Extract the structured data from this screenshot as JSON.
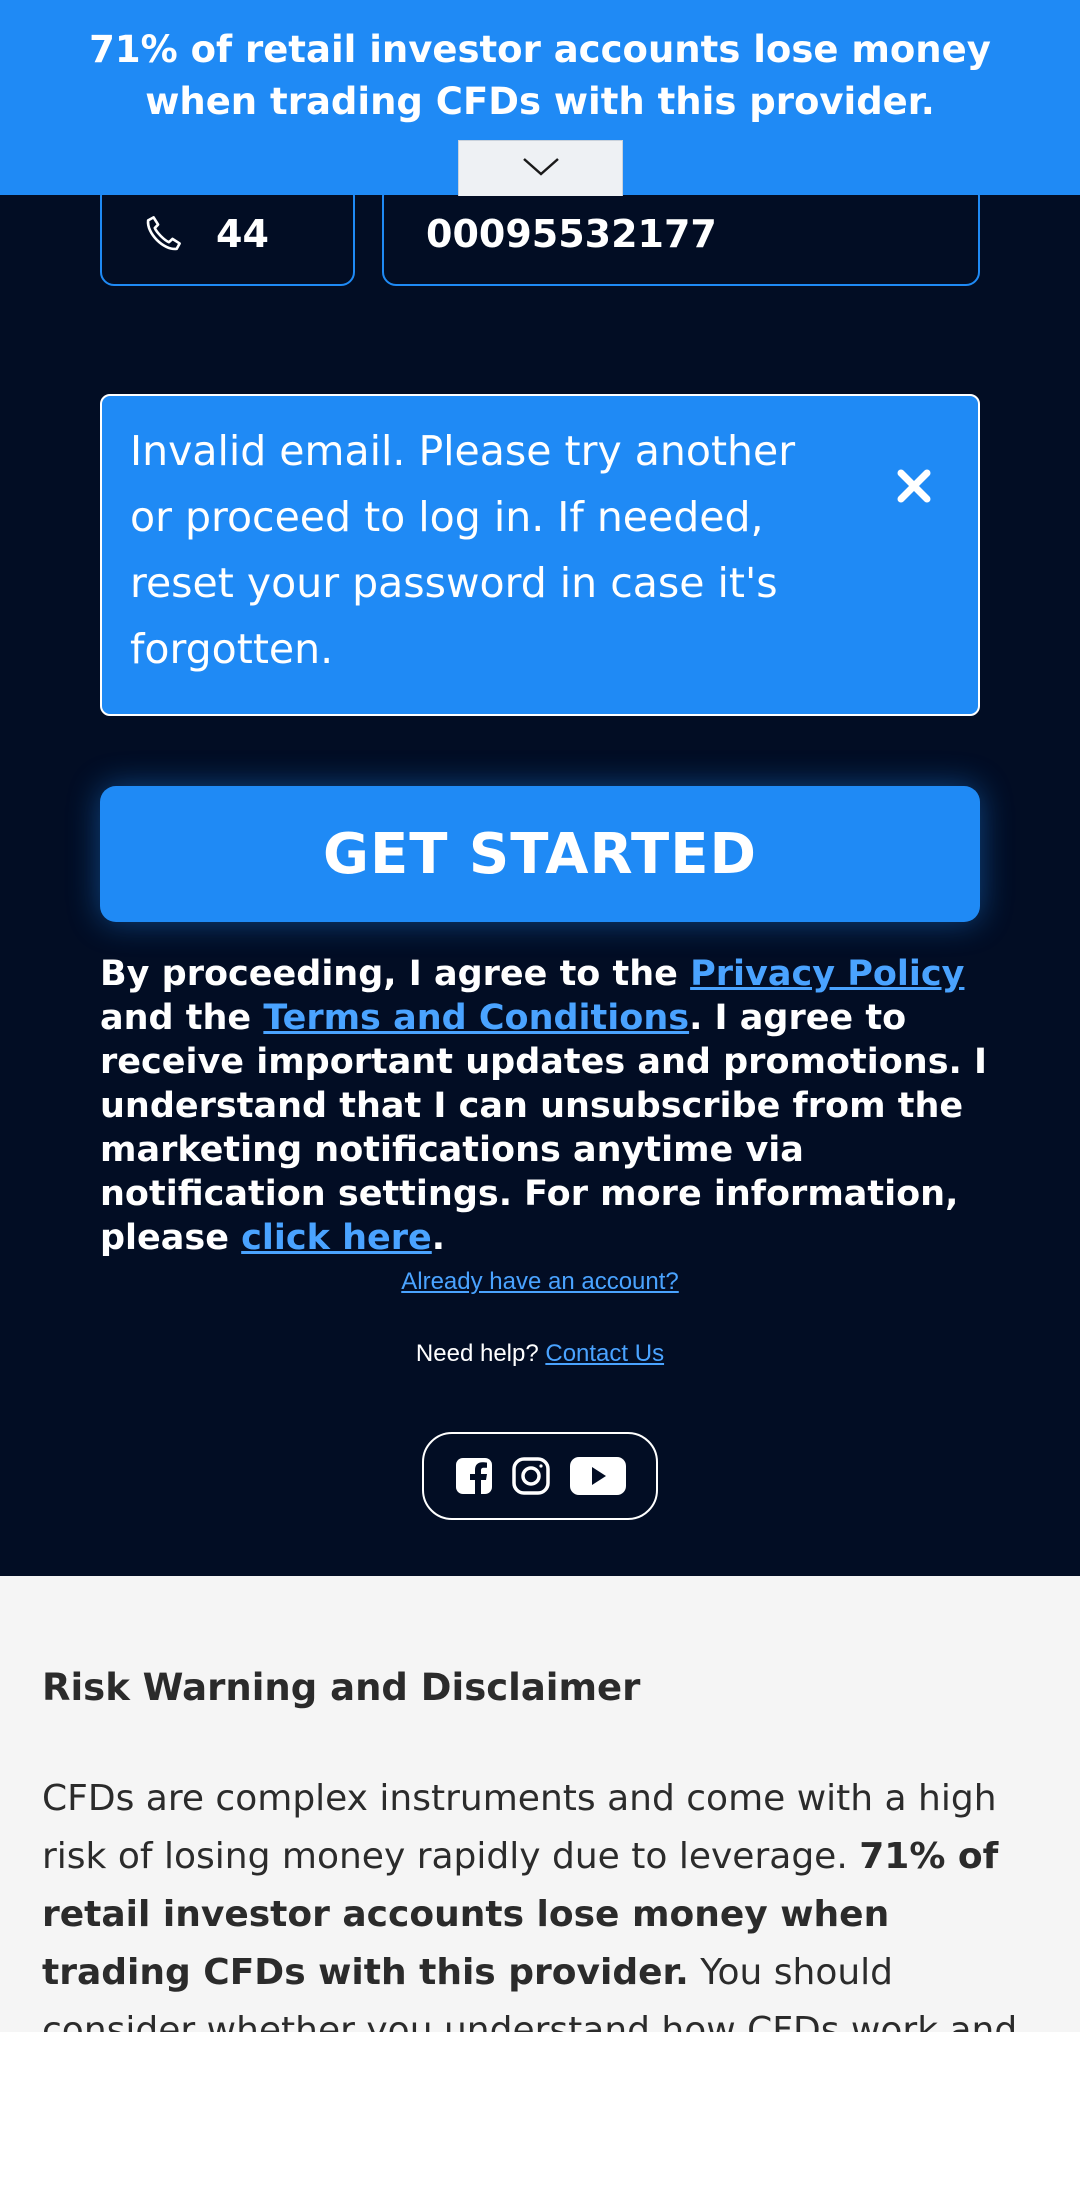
{
  "banner": {
    "text": "71% of retail investor accounts lose money when trading CFDs with this provider.",
    "toggle_icon": "chevron-down-icon"
  },
  "phone": {
    "icon": "phone-icon",
    "prefix": "44",
    "number": "00095532177"
  },
  "error": {
    "message": "Invalid email. Please try another or proceed to log in. If needed, reset your password in case it's forgotten.",
    "close_icon": "close-icon",
    "close_glyph": "✕"
  },
  "cta": {
    "label": "GET STARTED"
  },
  "consent": {
    "part1": "By proceeding, I agree to the ",
    "privacy_link": "Privacy Policy",
    "part2": " and the ",
    "terms_link": "Terms and Conditions",
    "part3": ". I agree to receive important updates and promotions. I understand that I can unsubscribe from the marketing notifications anytime via notification settings. For more information, please ",
    "click_link": "click here",
    "part4": "."
  },
  "account_link": "Already have an account?",
  "help": {
    "label": "Need help? ",
    "contact_link": "Contact Us"
  },
  "socials": [
    "facebook-icon",
    "instagram-icon",
    "youtube-icon"
  ],
  "disclaimer": {
    "title": "Risk Warning and Disclaimer",
    "body_part1": "CFDs are complex instruments and come with a high risk of losing money rapidly due to leverage. ",
    "body_bold": "71% of retail investor accounts lose money when trading CFDs with this provider.",
    "body_part2": " You should consider whether you understand how CFDs work and whether you can"
  },
  "colors": {
    "accent": "#1f8af5",
    "dark_background": "#020d24",
    "link": "#4aa3ff",
    "disclaimer_background": "#f5f5f5"
  }
}
